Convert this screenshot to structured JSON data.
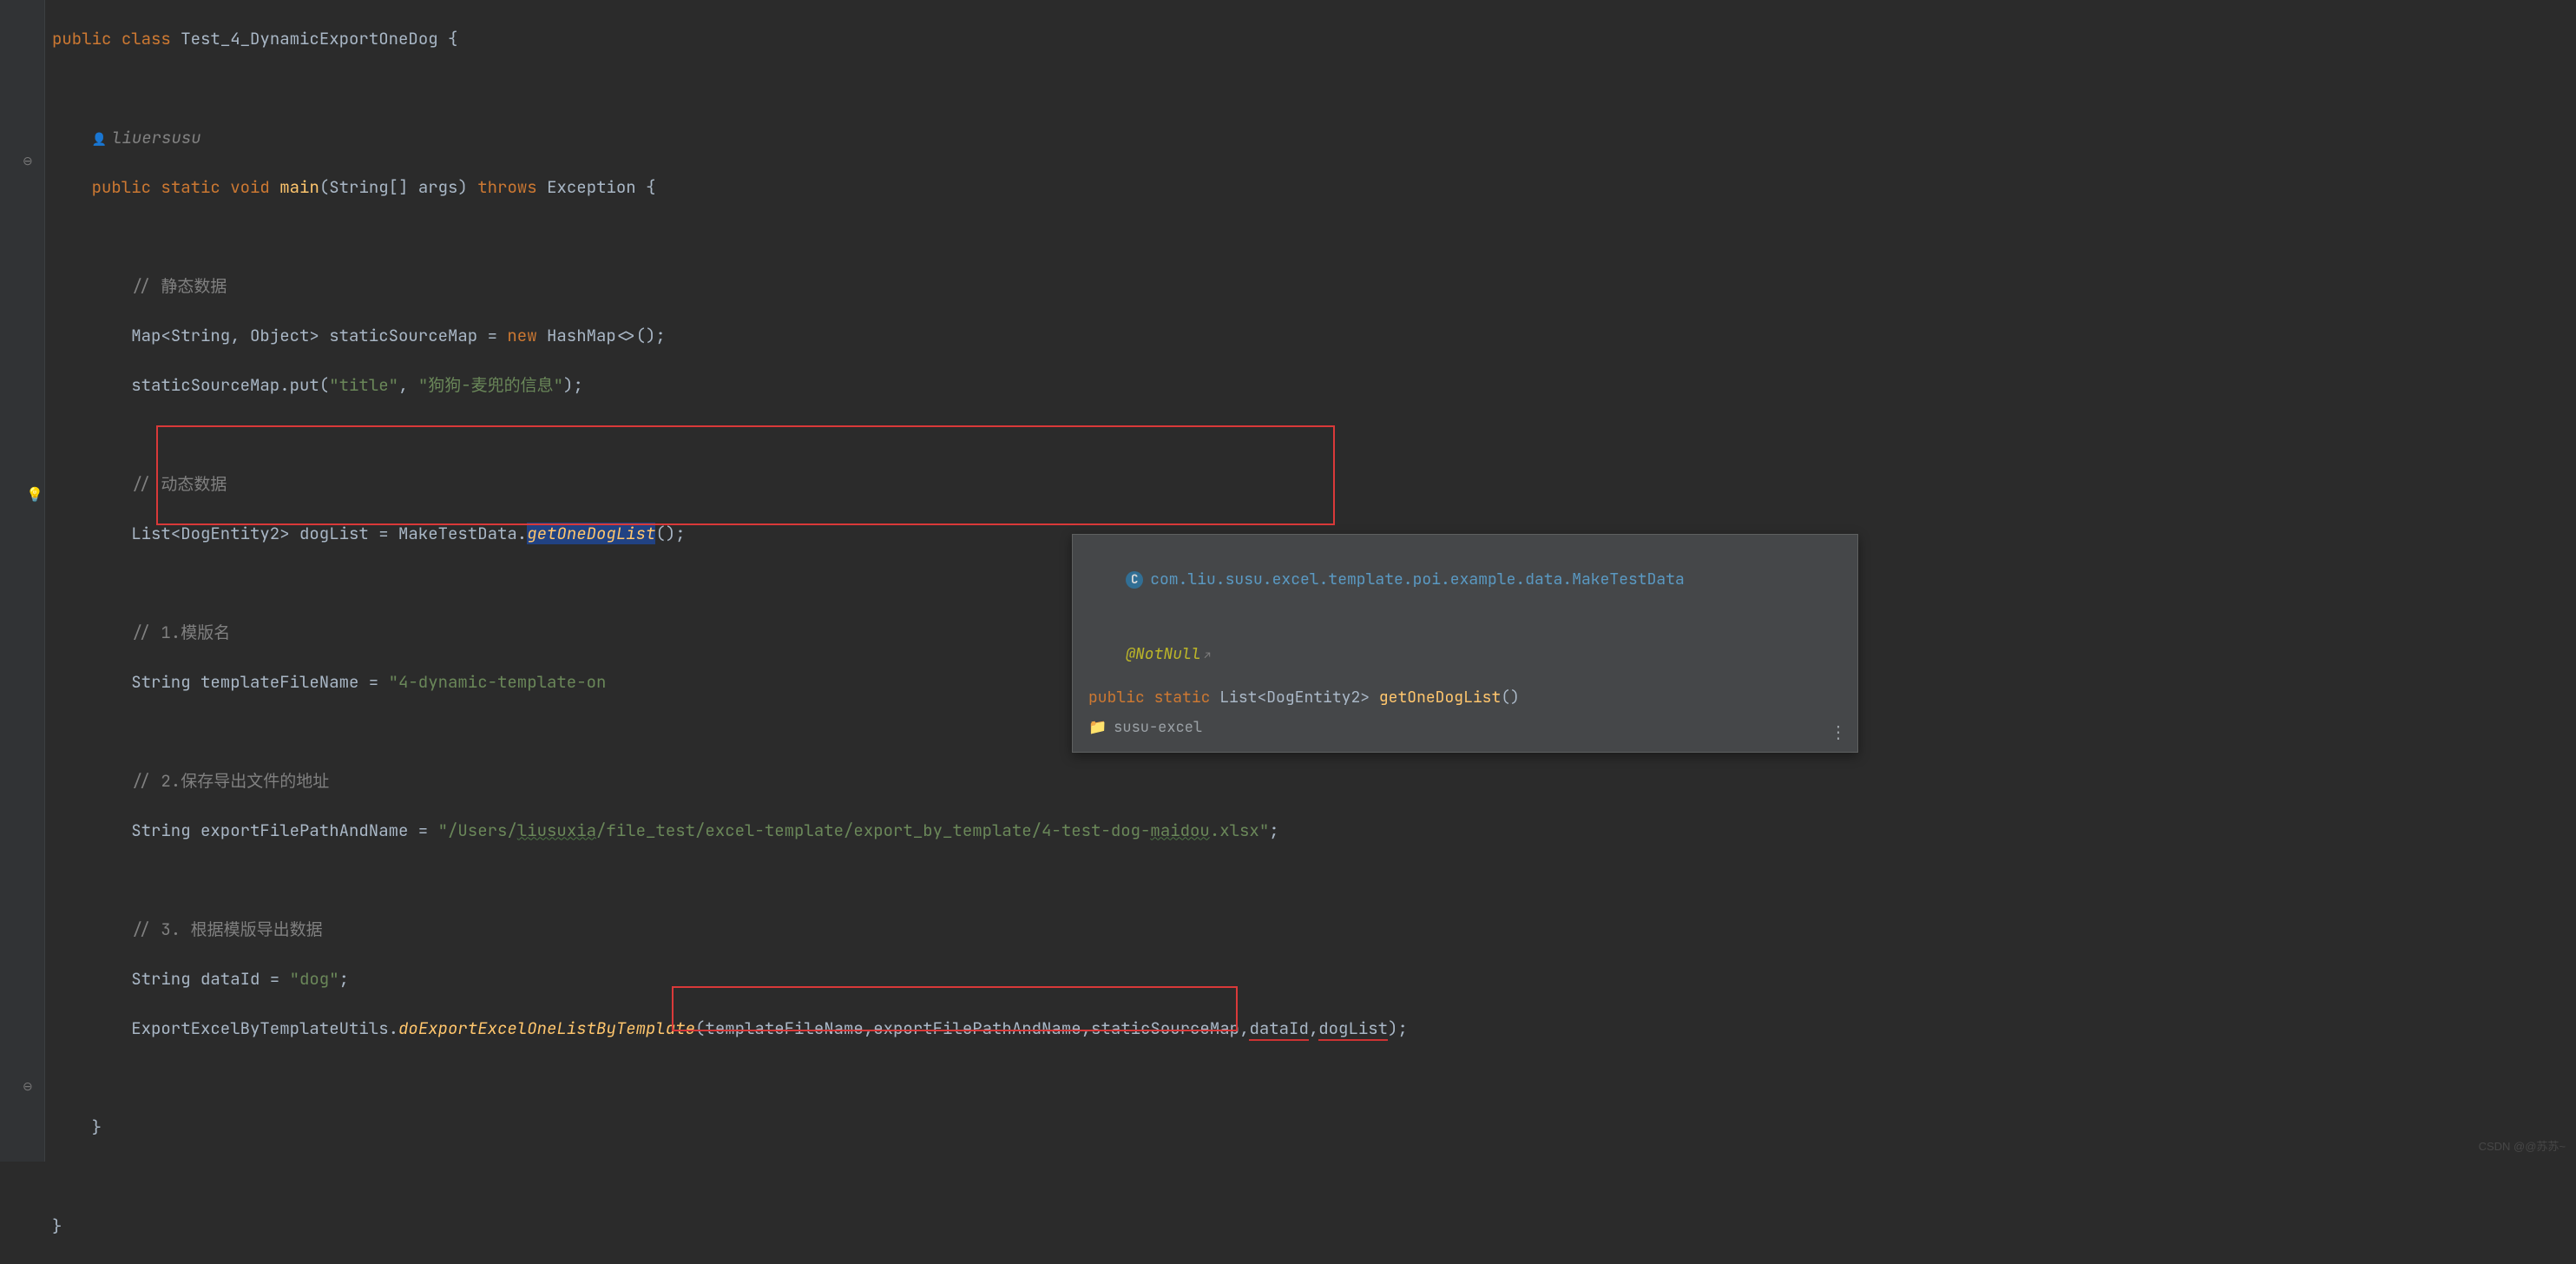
{
  "author": {
    "name": "liuersusu"
  },
  "code": {
    "l1_public": "public",
    "l1_class": "class",
    "l1_className": "Test_4_DynamicExportOneDog",
    "l1_brace": " {",
    "l3_public": "public",
    "l3_static": "static",
    "l3_void": "void",
    "l3_main": "main",
    "l3_params": "(String[] args)",
    "l3_throws": "throws",
    "l3_exception": "Exception {",
    "c1": "// 静态数据",
    "l5_a": "Map<String, Object> staticSourceMap = ",
    "l5_new": "new",
    "l5_b": " HashMap<>();",
    "l6_a": "staticSourceMap.put(",
    "l6_s1": "\"title\"",
    "l6_comma": ", ",
    "l6_s2": "\"狗狗-麦兜的信息\"",
    "l6_b": ");",
    "c2": "// 动态数据",
    "l8_a": "List<DogEntity2> dogList = MakeTestData.",
    "l8_m": "getOneDogList",
    "l8_b": "();",
    "c3": "// 1.模版名",
    "l10_a": "String templateFileName = ",
    "l10_s": "\"4-dynamic-template-on",
    "c4": "// 2.保存导出文件的地址",
    "l12_a": "String exportFilePathAndName = ",
    "l12_s1": "\"/Users/",
    "l12_u": "liusuxia",
    "l12_s2": "/file_test/excel-template/export_by_template/4-test-dog-",
    "l12_u2": "maidou",
    "l12_s3": ".xlsx\"",
    "l12_b": ";",
    "c5": "// 3. 根据模版导出数据",
    "l14_a": "String dataId = ",
    "l14_s": "\"dog\"",
    "l14_b": ";",
    "l15_a": "ExportExcelByTemplateUtils.",
    "l15_m": "doExportExcelOneListByTemplate",
    "l15_b": "(templateFileName,exportFilePathAndName,staticSourceMap,",
    "l15_c": "dataId",
    "l15_comma": ",",
    "l15_d": "dogList",
    "l15_e": ");",
    "brace_close": "}"
  },
  "popup": {
    "fqn": "com.liu.susu.excel.template.poi.example.data.MakeTestData",
    "annot": "@NotNull",
    "sig_public": "public",
    "sig_static": "static",
    "sig_ret": "List<DogEntity2>",
    "sig_method": "getOneDogList",
    "sig_parens": "()",
    "module": "susu-excel"
  },
  "watermark": "CSDN @@苏苏~"
}
